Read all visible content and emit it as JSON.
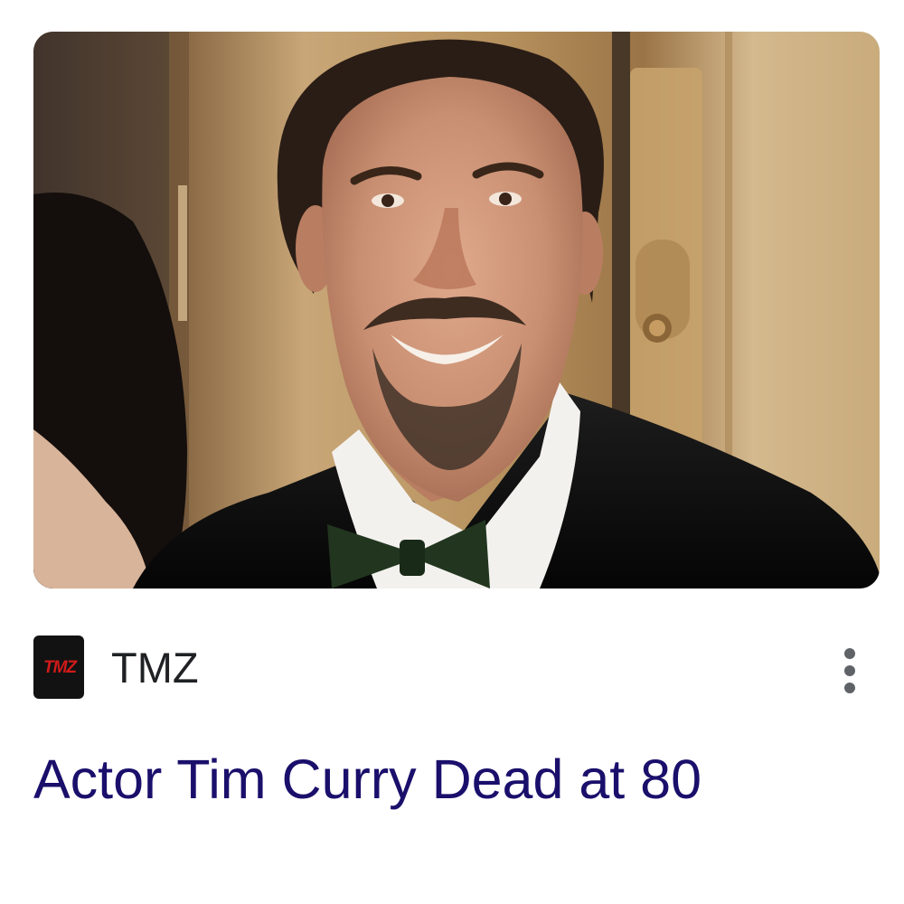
{
  "article": {
    "image": {
      "alt_icon": "article-photo",
      "tones": {
        "door_gold": "#b08a55",
        "door_light": "#dcc39a",
        "suit": "#111111",
        "shirt": "#f3f1ee",
        "bowtie": "#22361f",
        "skin": "#c98f72",
        "hair": "#2a1d16"
      }
    },
    "source": {
      "name": "TMZ",
      "favicon_text": "TMZ",
      "favicon_bg": "#121212",
      "favicon_accent": "#d01a1a"
    },
    "menu_icon": "more-vert-icon",
    "headline": "Actor Tim Curry Dead at 80",
    "headline_color": "#1a0f6b"
  }
}
